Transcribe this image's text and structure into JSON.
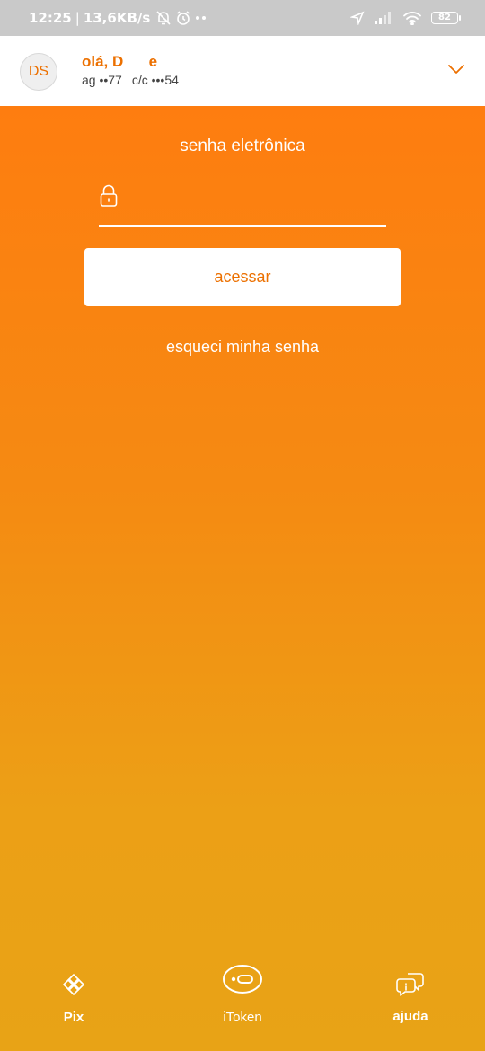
{
  "status_bar": {
    "time": "12:25",
    "separator": "|",
    "network_speed": "13,6KB/s",
    "battery_level": "82",
    "icons": [
      "mute-icon",
      "alarm-icon",
      "more-dots-icon",
      "location-arrow-icon",
      "signal-icon",
      "wifi-icon",
      "battery-icon"
    ]
  },
  "account": {
    "initials": "DS",
    "greeting": "olá, D      e",
    "agency": "ag ••77",
    "account_number": "c/c •••54",
    "expand_icon": "chevron-down-icon"
  },
  "login": {
    "label": "senha eletrônica",
    "password_value": "",
    "field_icon": "lock-icon",
    "submit_label": "acessar",
    "forgot_label": "esqueci minha senha"
  },
  "bottom_nav": {
    "pix": {
      "label": "Pix",
      "icon": "pix-icon"
    },
    "itoken": {
      "label": "iToken",
      "icon": "itoken-icon"
    },
    "ajuda": {
      "label": "ajuda",
      "icon": "help-chat-icon"
    }
  },
  "colors": {
    "brand_orange": "#ec7000",
    "gradient_top": "#fe7d10",
    "gradient_bottom": "#e8a316",
    "status_bar": "#c9c9c9",
    "header_bg": "#ffffff"
  }
}
